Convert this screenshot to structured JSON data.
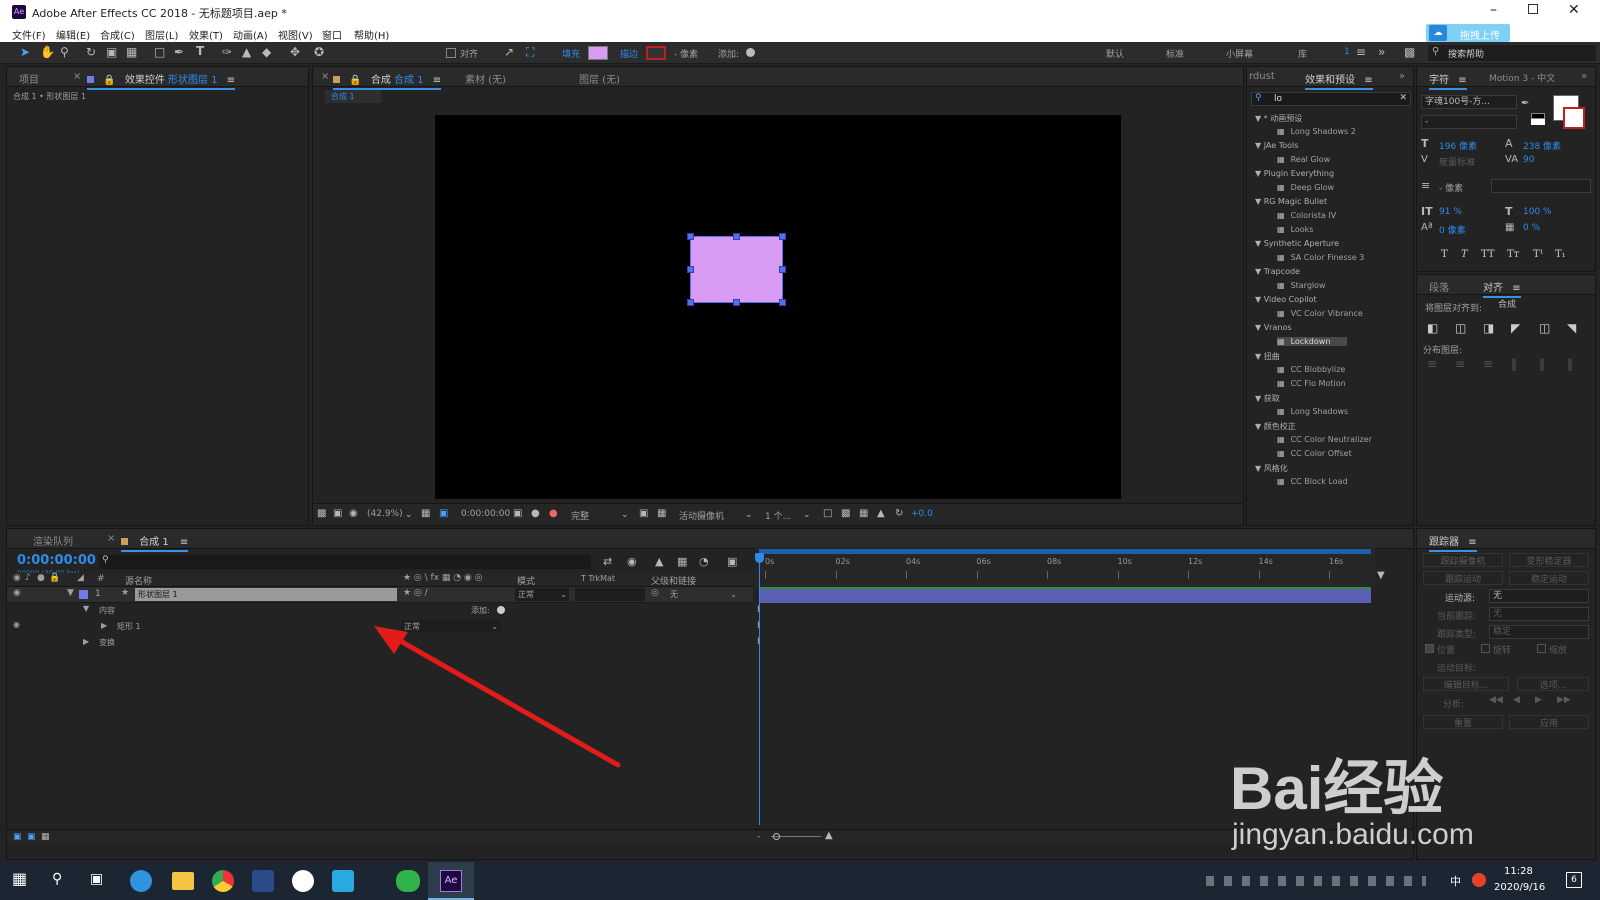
{
  "window": {
    "title": "Adobe After Effects CC 2018 - 无标题项目.aep *",
    "app_icon": "Ae"
  },
  "menu": [
    "文件(F)",
    "编辑(E)",
    "合成(C)",
    "图层(L)",
    "效果(T)",
    "动画(A)",
    "视图(V)",
    "窗口",
    "帮助(H)"
  ],
  "upload_button": "拖拽上传",
  "toolbar": {
    "align_label": "对齐",
    "fill_label": "填充",
    "stroke_label": "描边",
    "pixel_label": "- 像素",
    "add_label": "添加:",
    "fill_color": "#d99cf5",
    "stroke_color": "#c02020",
    "workspaces": [
      "默认",
      "标准",
      "小屏幕",
      "库"
    ],
    "workspace_count": "1",
    "search_help_placeholder": "搜索帮助"
  },
  "project_panel": {
    "tab_project": "项目",
    "tab_effect_controls_prefix": "效果控件",
    "tab_effect_controls_layer": "形状图层 1",
    "breadcrumb": "合成 1 • 形状图层 1"
  },
  "comp_panel": {
    "tab_comp_prefix": "合成",
    "tab_comp_name": "合成 1",
    "tab_footage": "素材 (无)",
    "tab_layer": "图层 (无)",
    "sub_tab": "合成 1",
    "zoom": "(42.9%)",
    "timecode": "0:00:00:00",
    "resolution": "完整",
    "camera": "活动摄像机",
    "views": "1 个...",
    "exposure": "+0.0",
    "shape_color": "#d99cf5"
  },
  "effects_panel": {
    "tab_left": "rdust",
    "tab_main": "效果和预设",
    "search_value": "lo",
    "groups": [
      {
        "name": "* 动画预设",
        "items": [
          "Long Shadows 2"
        ]
      },
      {
        "name": "JAe Tools",
        "items": [
          "Real Glow"
        ]
      },
      {
        "name": "Plugin Everything",
        "items": [
          "Deep Glow"
        ]
      },
      {
        "name": "RG Magic Bullet",
        "items": [
          "Colorista IV",
          "Looks"
        ]
      },
      {
        "name": "Synthetic Aperture",
        "items": [
          "SA Color Finesse 3"
        ]
      },
      {
        "name": "Trapcode",
        "items": [
          "Starglow"
        ]
      },
      {
        "name": "Video Copilot",
        "items": [
          "VC Color Vibrance"
        ]
      },
      {
        "name": "Vranos",
        "items": [
          "Lockdown"
        ]
      },
      {
        "name": "扭曲",
        "items": [
          "CC Blobbylize",
          "CC Flo Motion"
        ]
      },
      {
        "name": "获取",
        "items": [
          "Long Shadows"
        ]
      },
      {
        "name": "颜色校正",
        "items": [
          "CC Color Neutralizer",
          "CC Color Offset"
        ]
      },
      {
        "name": "风格化",
        "items": [
          "CC Block Load"
        ]
      }
    ]
  },
  "character_panel": {
    "tab": "字符",
    "tab2": "Motion 3 - 中文",
    "font": "字魂100号-方...",
    "style": "-",
    "font_size": "196 像素",
    "leading": "238 像素",
    "kerning": "度量标准",
    "tracking": "90",
    "stroke_width": "- 像素",
    "vscale": "91 %",
    "hscale": "100 %",
    "baseline": "0 像素",
    "tsume": "0 %",
    "style_buttons": [
      "T",
      "T",
      "TT",
      "Tт",
      "T¹",
      "T₁"
    ]
  },
  "align_panel": {
    "tab_paragraph": "段落",
    "tab_align": "对齐",
    "align_to_label": "将图层对齐到:",
    "align_to_value": "合成",
    "distribute_label": "分布图层:"
  },
  "tracker_panel": {
    "title": "跟踪器",
    "buttons": [
      "跟踪摄像机",
      "变形稳定器",
      "跟踪运动",
      "稳定运动"
    ],
    "motion_source_label": "运动源:",
    "motion_source_value": "无",
    "current_track_label": "当前跟踪:",
    "current_track_value": "无",
    "track_type_label": "跟踪类型:",
    "track_type_value": "稳定",
    "checkboxes": [
      "位置",
      "旋转",
      "缩放"
    ],
    "motion_target_label": "运动目标:",
    "edit_target": "编辑目标...",
    "options": "选项...",
    "analyze_label": "分析:",
    "reset": "重置",
    "apply": "应用"
  },
  "timeline": {
    "tab_render": "渲染队列",
    "tab_comp": "合成 1",
    "timecode": "0:00:00:00",
    "timecode_sub": "00000 (30.00 fps)",
    "col_source_name": "源名称",
    "col_mode": "模式",
    "col_trkmat": "T  TrkMat",
    "col_parent": "父级和链接",
    "layer_number": "1",
    "layer_name": "形状图层 1",
    "layer_mode": "正常",
    "layer_parent": "无",
    "contents_label": "内容",
    "add_label": "添加:",
    "rect_label": "矩形 1",
    "rect_mode": "正常",
    "transform_label": "变换",
    "ruler_ticks": [
      "0s",
      "02s",
      "04s",
      "06s",
      "08s",
      "10s",
      "12s",
      "14s",
      "16s"
    ]
  },
  "watermark": {
    "brand": "Bai经验",
    "url": "jingyan.baidu.com"
  },
  "taskbar": {
    "time": "11:28",
    "date": "2020/9/16",
    "ime": "中",
    "notif_count": "6"
  }
}
